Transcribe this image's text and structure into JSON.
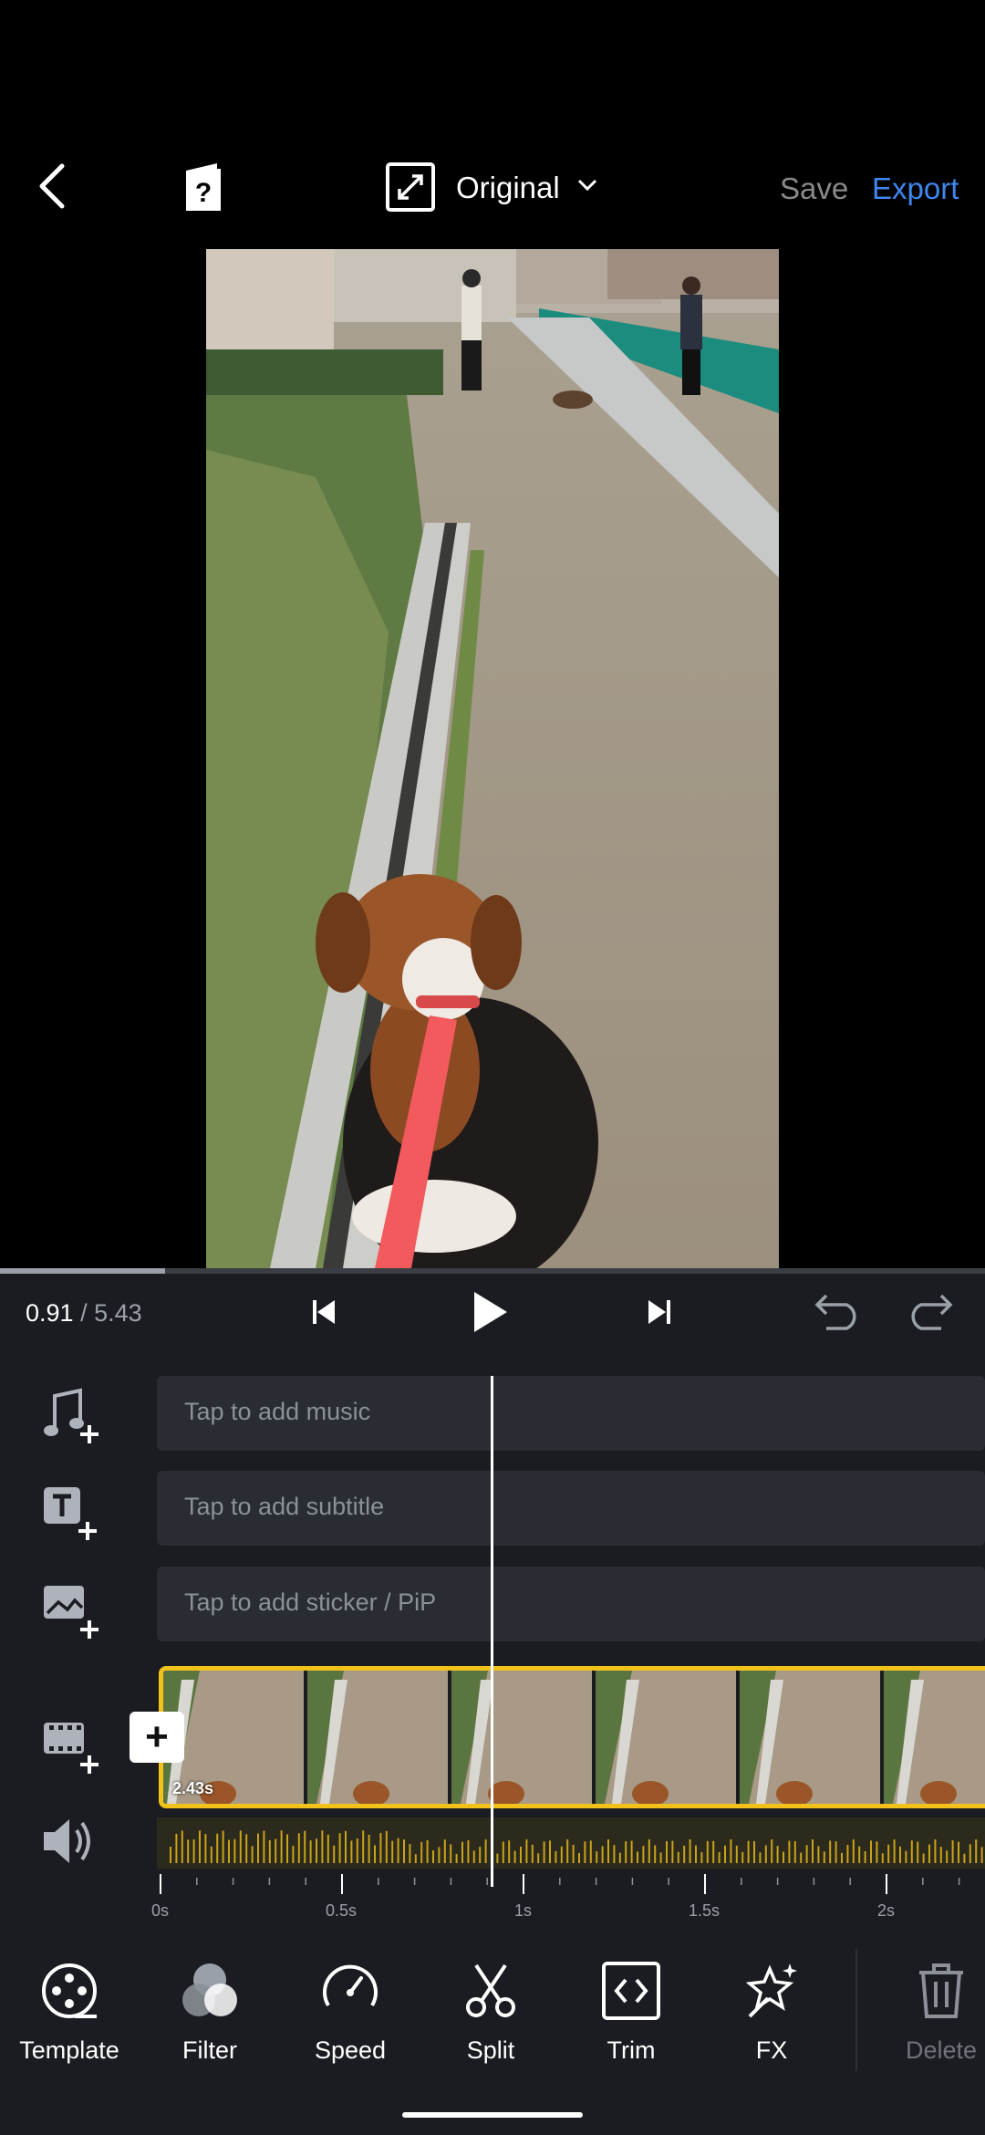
{
  "header": {
    "aspect_ratio_label": "Original",
    "save_label": "Save",
    "export_label": "Export"
  },
  "playback": {
    "current_time": "0.91",
    "separator": " / ",
    "total_time": "5.43",
    "progress_fraction": 0.168
  },
  "tracks": {
    "music_placeholder": "Tap to add music",
    "subtitle_placeholder": "Tap to add subtitle",
    "sticker_placeholder": "Tap to add sticker / PiP",
    "clip_duration": "2.43s"
  },
  "ruler": {
    "labels": [
      "0s",
      "0.5s",
      "1s",
      "1.5s",
      "2s"
    ]
  },
  "toolbar": {
    "template": "Template",
    "filter": "Filter",
    "speed": "Speed",
    "split": "Split",
    "trim": "Trim",
    "fx": "FX",
    "delete": "Delete"
  },
  "colors": {
    "accent_blue": "#3f86ee",
    "clip_border": "#f2c21b",
    "panel_bg": "#1b1c21",
    "leash": "#f25a5e"
  },
  "icons": [
    "back-icon",
    "help-book-icon",
    "expand-icon",
    "chevron-down-icon",
    "skip-back-icon",
    "play-icon",
    "skip-forward-icon",
    "undo-icon",
    "redo-icon",
    "music-add-icon",
    "text-add-icon",
    "image-add-icon",
    "video-add-icon",
    "volume-icon",
    "template-icon",
    "filter-icon",
    "speed-icon",
    "scissors-icon",
    "trim-icon",
    "fx-icon",
    "trash-icon"
  ]
}
